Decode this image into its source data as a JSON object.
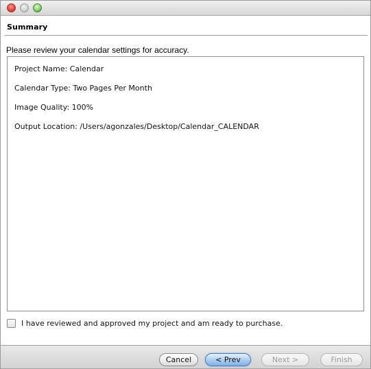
{
  "header": {
    "title": "Summary"
  },
  "instruction": "Please review your calendar settings for accuracy.",
  "summary": {
    "lines": [
      "Project Name: Calendar",
      "Calendar Type: Two Pages Per Month",
      "Image Quality: 100%",
      "Output Location: /Users/agonzales/Desktop/Calendar_CALENDAR"
    ]
  },
  "confirm": {
    "label": "I have reviewed and approved my project and am ready to purchase.",
    "checked": false
  },
  "buttons": {
    "cancel": "Cancel",
    "prev": "< Prev",
    "next": "Next >",
    "finish": "Finish"
  },
  "colors": {
    "prev_button": "#a9cbee",
    "disabled_text": "#9a9a9a",
    "close_light": "#e0443a",
    "zoom_light": "#7fcf63"
  },
  "icons": {
    "close": "close-traffic-light-icon",
    "minimize": "minimize-traffic-light-icon",
    "zoom": "zoom-traffic-light-icon",
    "checkbox": "checkbox-unchecked-icon"
  }
}
